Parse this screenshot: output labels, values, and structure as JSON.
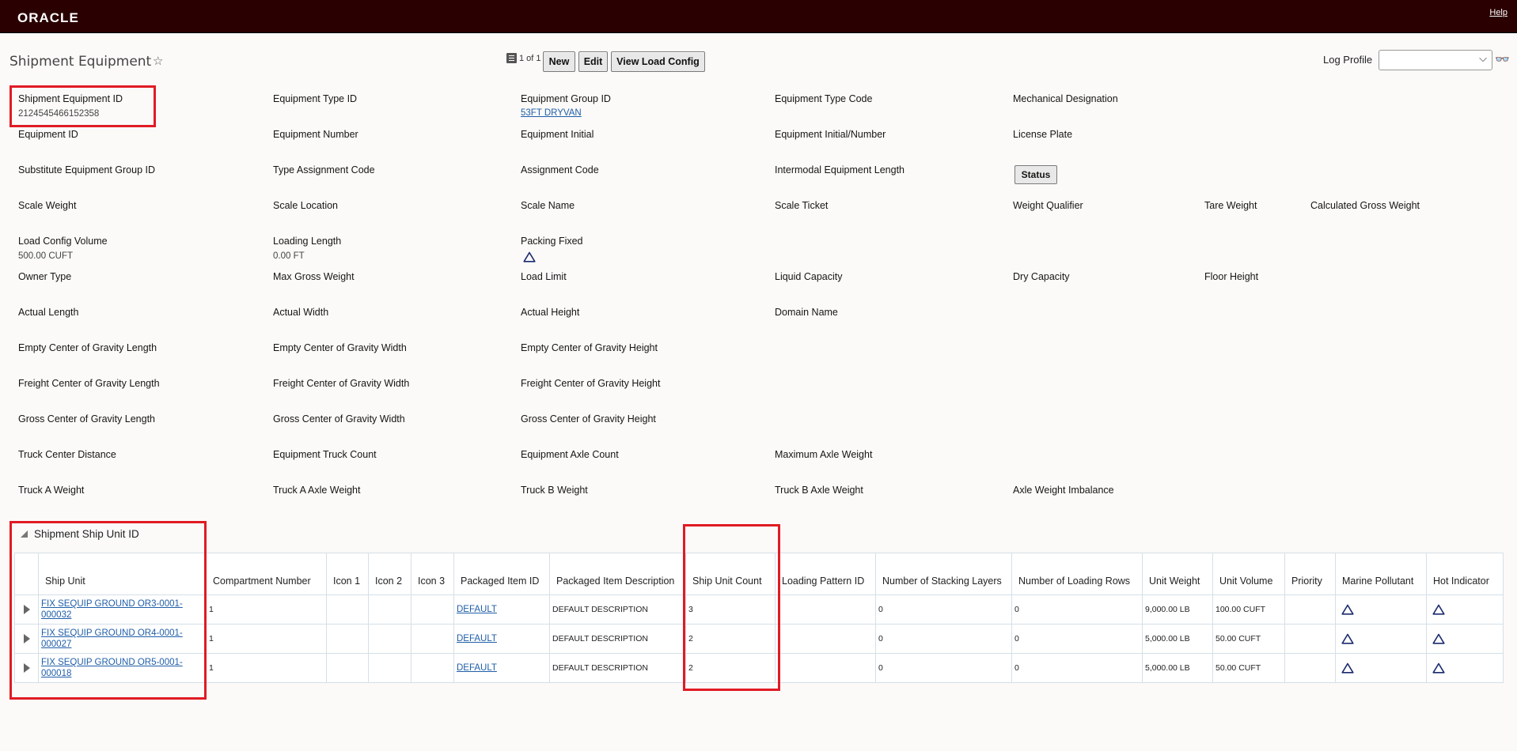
{
  "header": {
    "logo": "ORACLE",
    "help": "Help"
  },
  "page": {
    "title": "Shipment Equipment"
  },
  "record_nav": {
    "count": "1 of 1"
  },
  "buttons": {
    "new": "New",
    "edit": "Edit",
    "view_load_config": "View Load Config",
    "status": "Status"
  },
  "log_profile": {
    "label": "Log Profile",
    "value": ""
  },
  "fields": {
    "shipment_equipment_id": {
      "label": "Shipment Equipment ID",
      "value": "2124545466152358"
    },
    "equipment_type_id": {
      "label": "Equipment Type ID"
    },
    "equipment_group_id": {
      "label": "Equipment Group ID",
      "value": "53FT DRYVAN"
    },
    "equipment_type_code": {
      "label": "Equipment Type Code"
    },
    "mechanical_designation": {
      "label": "Mechanical Designation"
    },
    "equipment_id": {
      "label": "Equipment ID"
    },
    "equipment_number": {
      "label": "Equipment Number"
    },
    "equipment_initial": {
      "label": "Equipment Initial"
    },
    "equipment_initial_number": {
      "label": "Equipment Initial/Number"
    },
    "license_plate": {
      "label": "License Plate"
    },
    "substitute_equipment_group_id": {
      "label": "Substitute Equipment Group ID"
    },
    "type_assignment_code": {
      "label": "Type Assignment Code"
    },
    "assignment_code": {
      "label": "Assignment Code"
    },
    "intermodal_equipment_length": {
      "label": "Intermodal Equipment Length"
    },
    "scale_weight": {
      "label": "Scale Weight"
    },
    "scale_location": {
      "label": "Scale Location"
    },
    "scale_name": {
      "label": "Scale Name"
    },
    "scale_ticket": {
      "label": "Scale Ticket"
    },
    "weight_qualifier": {
      "label": "Weight Qualifier"
    },
    "tare_weight": {
      "label": "Tare Weight"
    },
    "calculated_gross_weight": {
      "label": "Calculated Gross Weight"
    },
    "load_config_volume": {
      "label": "Load Config Volume",
      "value": "500.00 CUFT"
    },
    "loading_length": {
      "label": "Loading Length",
      "value": "0.00 FT"
    },
    "packing_fixed": {
      "label": "Packing Fixed",
      "icon": "triangle-outline-icon"
    },
    "owner_type": {
      "label": "Owner Type"
    },
    "max_gross_weight": {
      "label": "Max Gross Weight"
    },
    "load_limit": {
      "label": "Load Limit"
    },
    "liquid_capacity": {
      "label": "Liquid Capacity"
    },
    "dry_capacity": {
      "label": "Dry Capacity"
    },
    "floor_height": {
      "label": "Floor Height"
    },
    "actual_length": {
      "label": "Actual Length"
    },
    "actual_width": {
      "label": "Actual Width"
    },
    "actual_height": {
      "label": "Actual Height"
    },
    "domain_name": {
      "label": "Domain Name"
    },
    "empty_cog_length": {
      "label": "Empty Center of Gravity Length"
    },
    "empty_cog_width": {
      "label": "Empty Center of Gravity Width"
    },
    "empty_cog_height": {
      "label": "Empty Center of Gravity Height"
    },
    "freight_cog_length": {
      "label": "Freight Center of Gravity Length"
    },
    "freight_cog_width": {
      "label": "Freight Center of Gravity Width"
    },
    "freight_cog_height": {
      "label": "Freight Center of Gravity Height"
    },
    "gross_cog_length": {
      "label": "Gross Center of Gravity Length"
    },
    "gross_cog_width": {
      "label": "Gross Center of Gravity Width"
    },
    "gross_cog_height": {
      "label": "Gross Center of Gravity Height"
    },
    "truck_center_distance": {
      "label": "Truck Center Distance"
    },
    "equipment_truck_count": {
      "label": "Equipment Truck Count"
    },
    "equipment_axle_count": {
      "label": "Equipment Axle Count"
    },
    "maximum_axle_weight": {
      "label": "Maximum Axle Weight"
    },
    "truck_a_weight": {
      "label": "Truck A Weight"
    },
    "truck_a_axle_weight": {
      "label": "Truck A Axle Weight"
    },
    "truck_b_weight": {
      "label": "Truck B Weight"
    },
    "truck_b_axle_weight": {
      "label": "Truck B Axle Weight"
    },
    "axle_weight_imbalance": {
      "label": "Axle Weight Imbalance"
    }
  },
  "ship_unit_section": {
    "title": "Shipment Ship Unit ID",
    "columns": {
      "ship_unit": "Ship Unit",
      "compartment_number": "Compartment Number",
      "icon1": "Icon 1",
      "icon2": "Icon 2",
      "icon3": "Icon 3",
      "packaged_item_id": "Packaged Item ID",
      "packaged_item_description": "Packaged Item Description",
      "ship_unit_count": "Ship Unit Count",
      "loading_pattern_id": "Loading Pattern ID",
      "number_of_stacking_layers": "Number of Stacking Layers",
      "number_of_loading_rows": "Number of Loading Rows",
      "unit_weight": "Unit Weight",
      "unit_volume": "Unit Volume",
      "priority": "Priority",
      "marine_pollutant": "Marine Pollutant",
      "hot_indicator": "Hot Indicator"
    },
    "rows": [
      {
        "ship_unit": "FIX SEQUIP GROUND OR3-0001-000032",
        "compartment_number": "1",
        "packaged_item_id": "DEFAULT",
        "packaged_item_description": "DEFAULT DESCRIPTION",
        "ship_unit_count": "3",
        "loading_pattern_id": "",
        "number_of_stacking_layers": "0",
        "number_of_loading_rows": "0",
        "unit_weight": "9,000.00 LB",
        "unit_volume": "100.00 CUFT",
        "priority": ""
      },
      {
        "ship_unit": "FIX SEQUIP GROUND OR4-0001-000027",
        "compartment_number": "1",
        "packaged_item_id": "DEFAULT",
        "packaged_item_description": "DEFAULT DESCRIPTION",
        "ship_unit_count": "2",
        "loading_pattern_id": "",
        "number_of_stacking_layers": "0",
        "number_of_loading_rows": "0",
        "unit_weight": "5,000.00 LB",
        "unit_volume": "50.00 CUFT",
        "priority": ""
      },
      {
        "ship_unit": "FIX SEQUIP GROUND OR5-0001-000018",
        "compartment_number": "1",
        "packaged_item_id": "DEFAULT",
        "packaged_item_description": "DEFAULT DESCRIPTION",
        "ship_unit_count": "2",
        "loading_pattern_id": "",
        "number_of_stacking_layers": "0",
        "number_of_loading_rows": "0",
        "unit_weight": "5,000.00 LB",
        "unit_volume": "50.00 CUFT",
        "priority": ""
      }
    ]
  },
  "colors": {
    "header_bg": "#2a0000",
    "link": "#1f5ea8",
    "highlight": "#e01b24"
  }
}
